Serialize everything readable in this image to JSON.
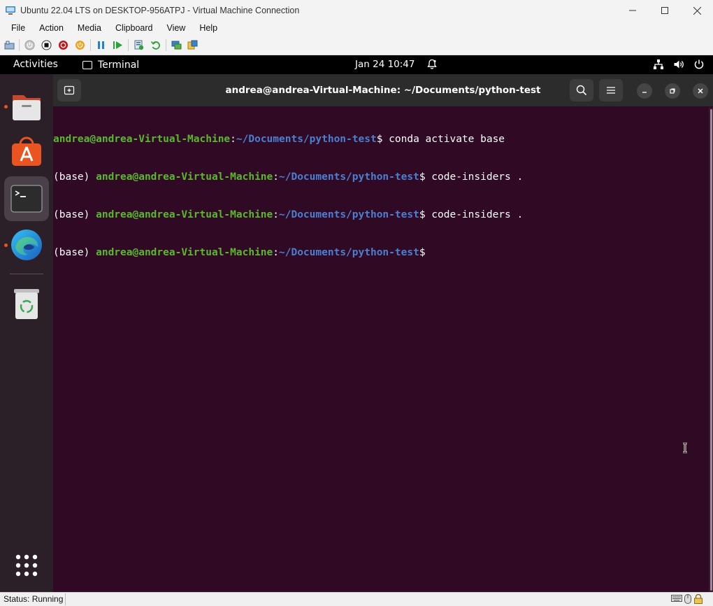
{
  "window": {
    "title": "Ubuntu 22.04 LTS on DESKTOP-956ATPJ - Virtual Machine Connection"
  },
  "menubar": {
    "items": [
      "File",
      "Action",
      "Media",
      "Clipboard",
      "View",
      "Help"
    ]
  },
  "ubuntu_topbar": {
    "activities": "Activities",
    "app": "Terminal",
    "clock": "Jan 24  10:47"
  },
  "terminal": {
    "title": "andrea@andrea-Virtual-Machine: ~/Documents/python-test",
    "lines": [
      {
        "prefix": "",
        "user": "andrea@andrea-Virtual-Machine",
        "sep": ":",
        "path": "~/Documents/python-test",
        "cmd": "$ conda activate base"
      },
      {
        "prefix": "(base) ",
        "user": "andrea@andrea-Virtual-Machine",
        "sep": ":",
        "path": "~/Documents/python-test",
        "cmd": "$ code-insiders ."
      },
      {
        "prefix": "(base) ",
        "user": "andrea@andrea-Virtual-Machine",
        "sep": ":",
        "path": "~/Documents/python-test",
        "cmd": "$ code-insiders ."
      },
      {
        "prefix": "(base) ",
        "user": "andrea@andrea-Virtual-Machine",
        "sep": ":",
        "path": "~/Documents/python-test",
        "cmd": "$ "
      }
    ]
  },
  "status": {
    "text": "Status: Running"
  },
  "colors": {
    "terminal_bg": "#300a24",
    "prompt_user": "#5ab82b",
    "prompt_path": "#4a7fd1",
    "ubuntu_orange": "#e95420"
  }
}
